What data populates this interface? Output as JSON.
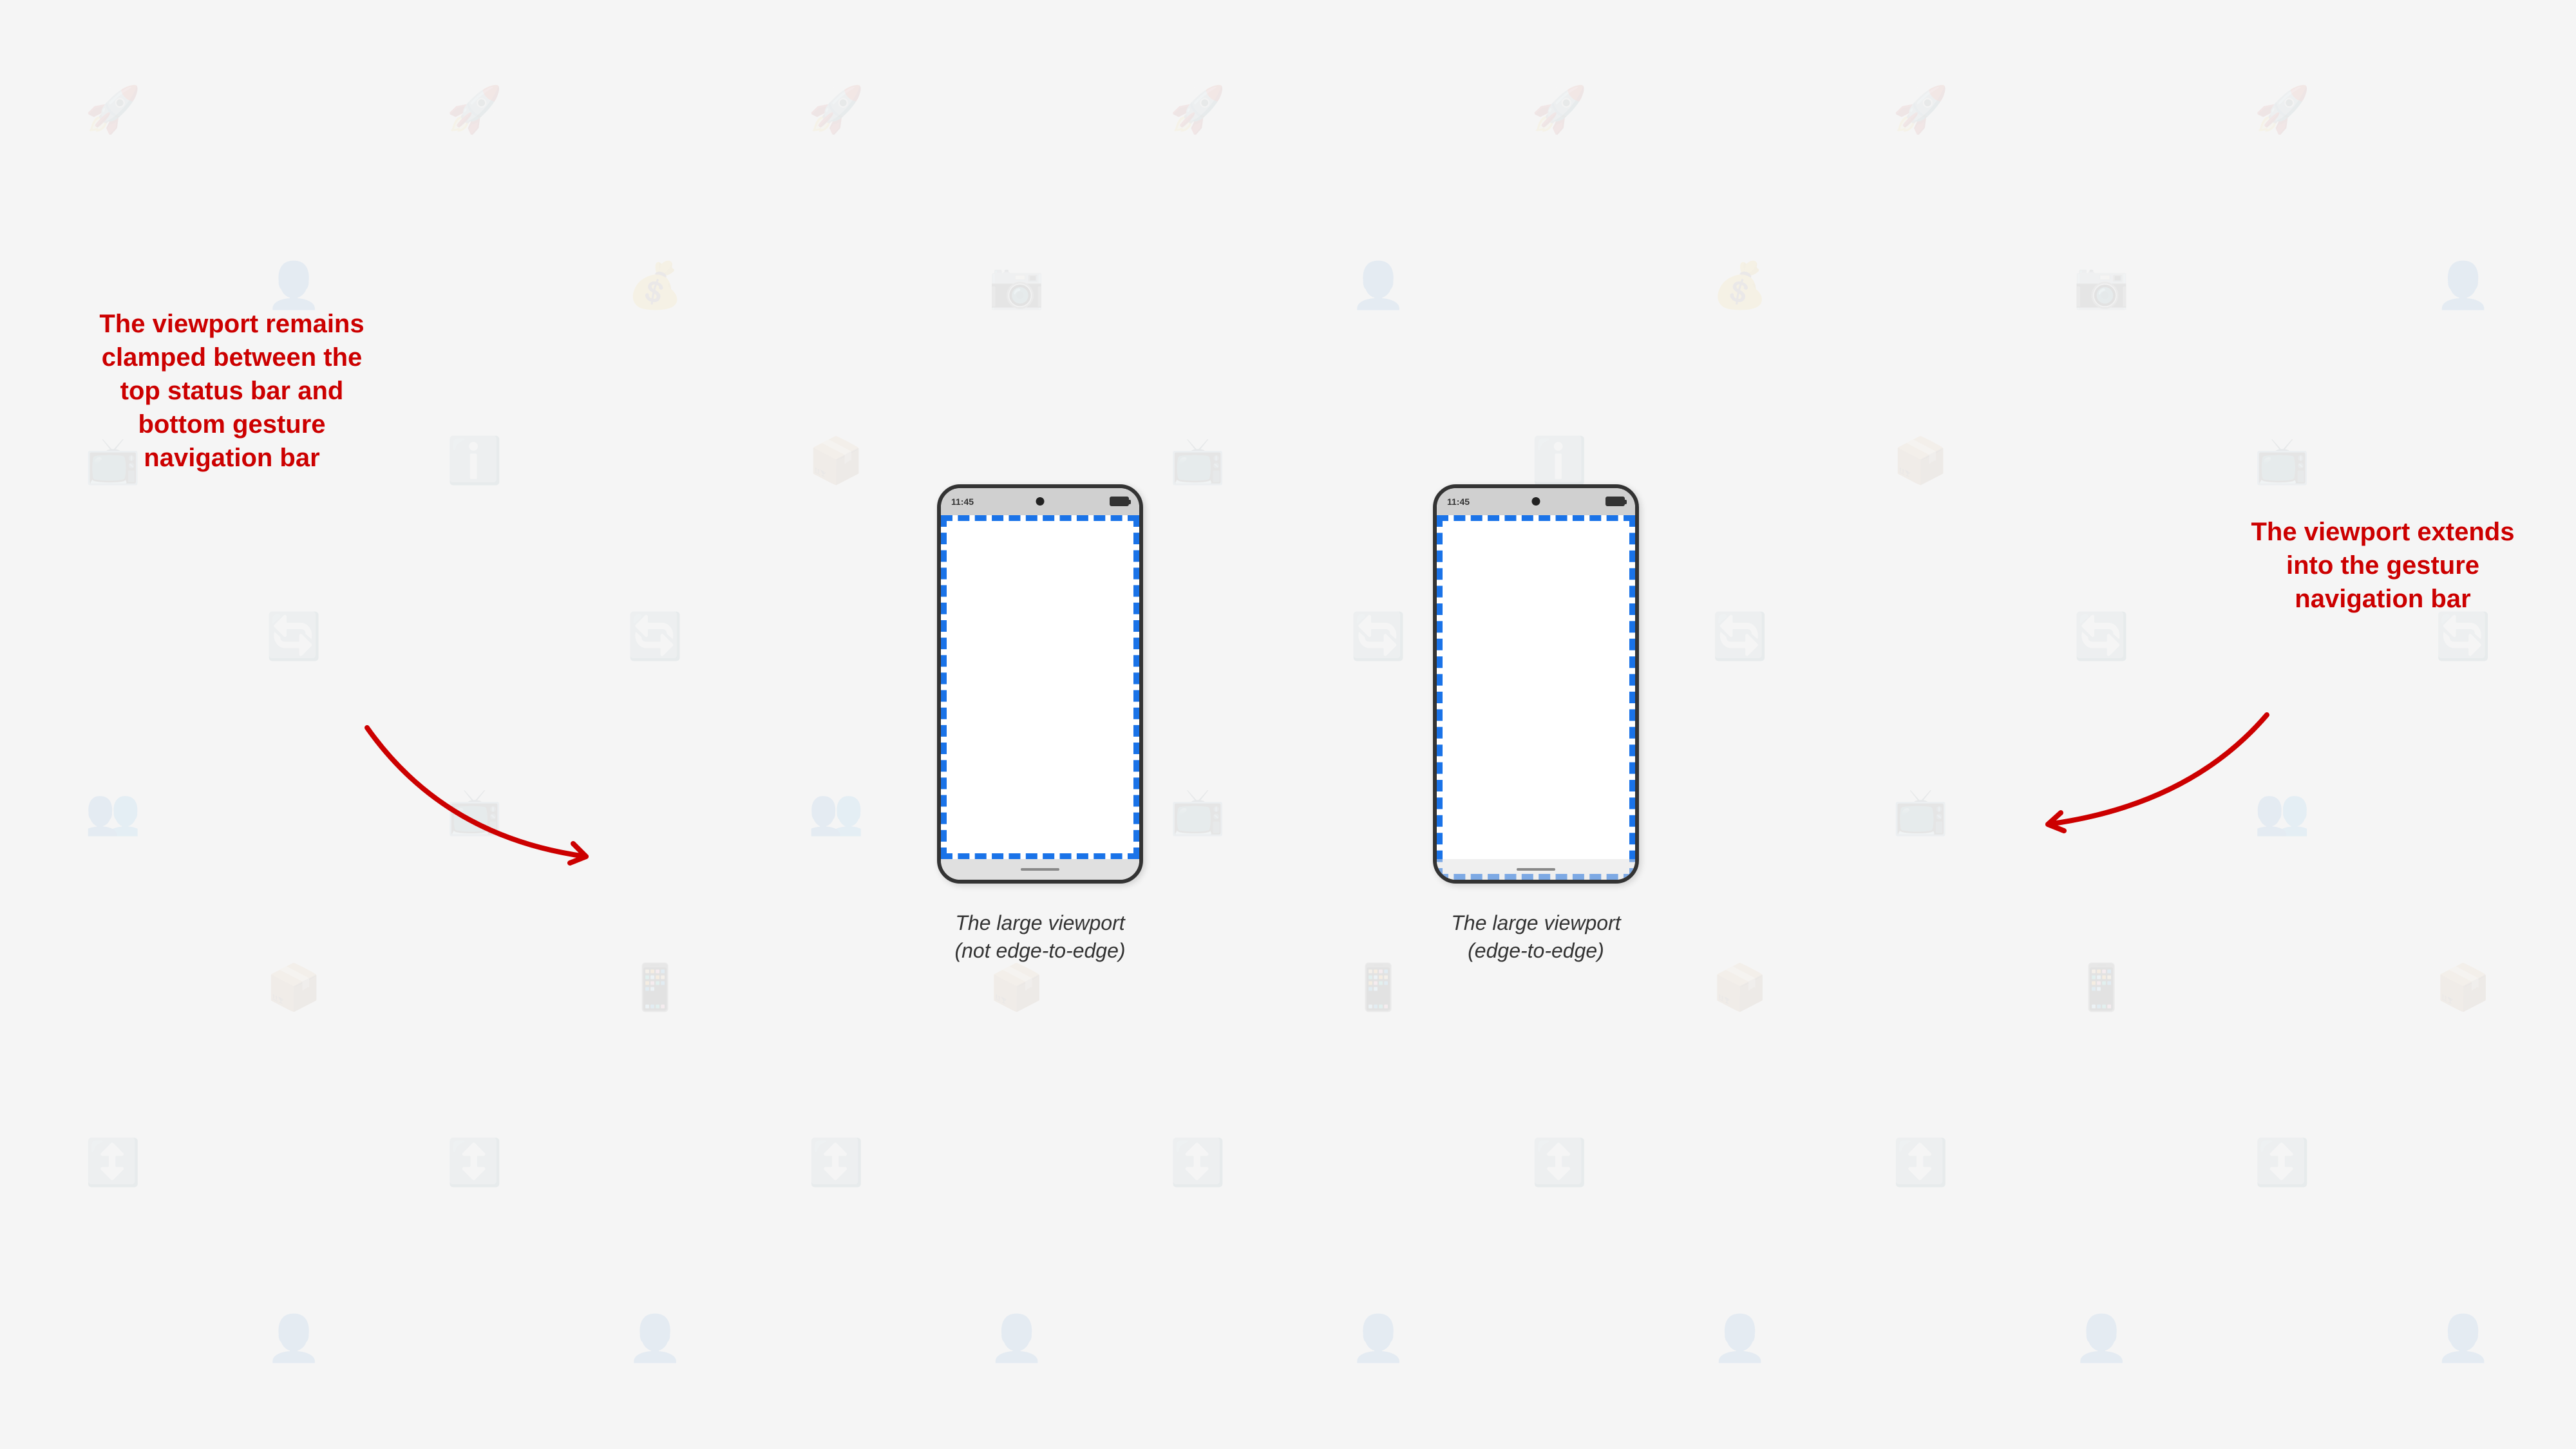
{
  "background": {
    "color": "#f5f5f5"
  },
  "annotations": {
    "left": {
      "text": "The viewport remains clamped between the top status bar and bottom gesture navigation bar",
      "lines": [
        "The viewport",
        "remains",
        "clamped",
        "between the",
        "top status bar",
        "and bottom",
        "gesture",
        "navigation bar"
      ]
    },
    "right": {
      "text": "The viewport extends into the gesture navigation bar",
      "lines": [
        "The viewport",
        "extends into the",
        "gesture navigation",
        "bar"
      ]
    }
  },
  "phones": {
    "left": {
      "time": "11:45",
      "caption_line1": "The large viewport",
      "caption_line2": "(not edge-to-edge)"
    },
    "right": {
      "time": "11:45",
      "caption_line1": "The large viewport",
      "caption_line2": "(edge-to-edge)"
    }
  },
  "colors": {
    "accent_red": "#cc0000",
    "viewport_border": "#1a73e8",
    "phone_border": "#333333",
    "status_bar_bg": "#d0d0d0"
  }
}
